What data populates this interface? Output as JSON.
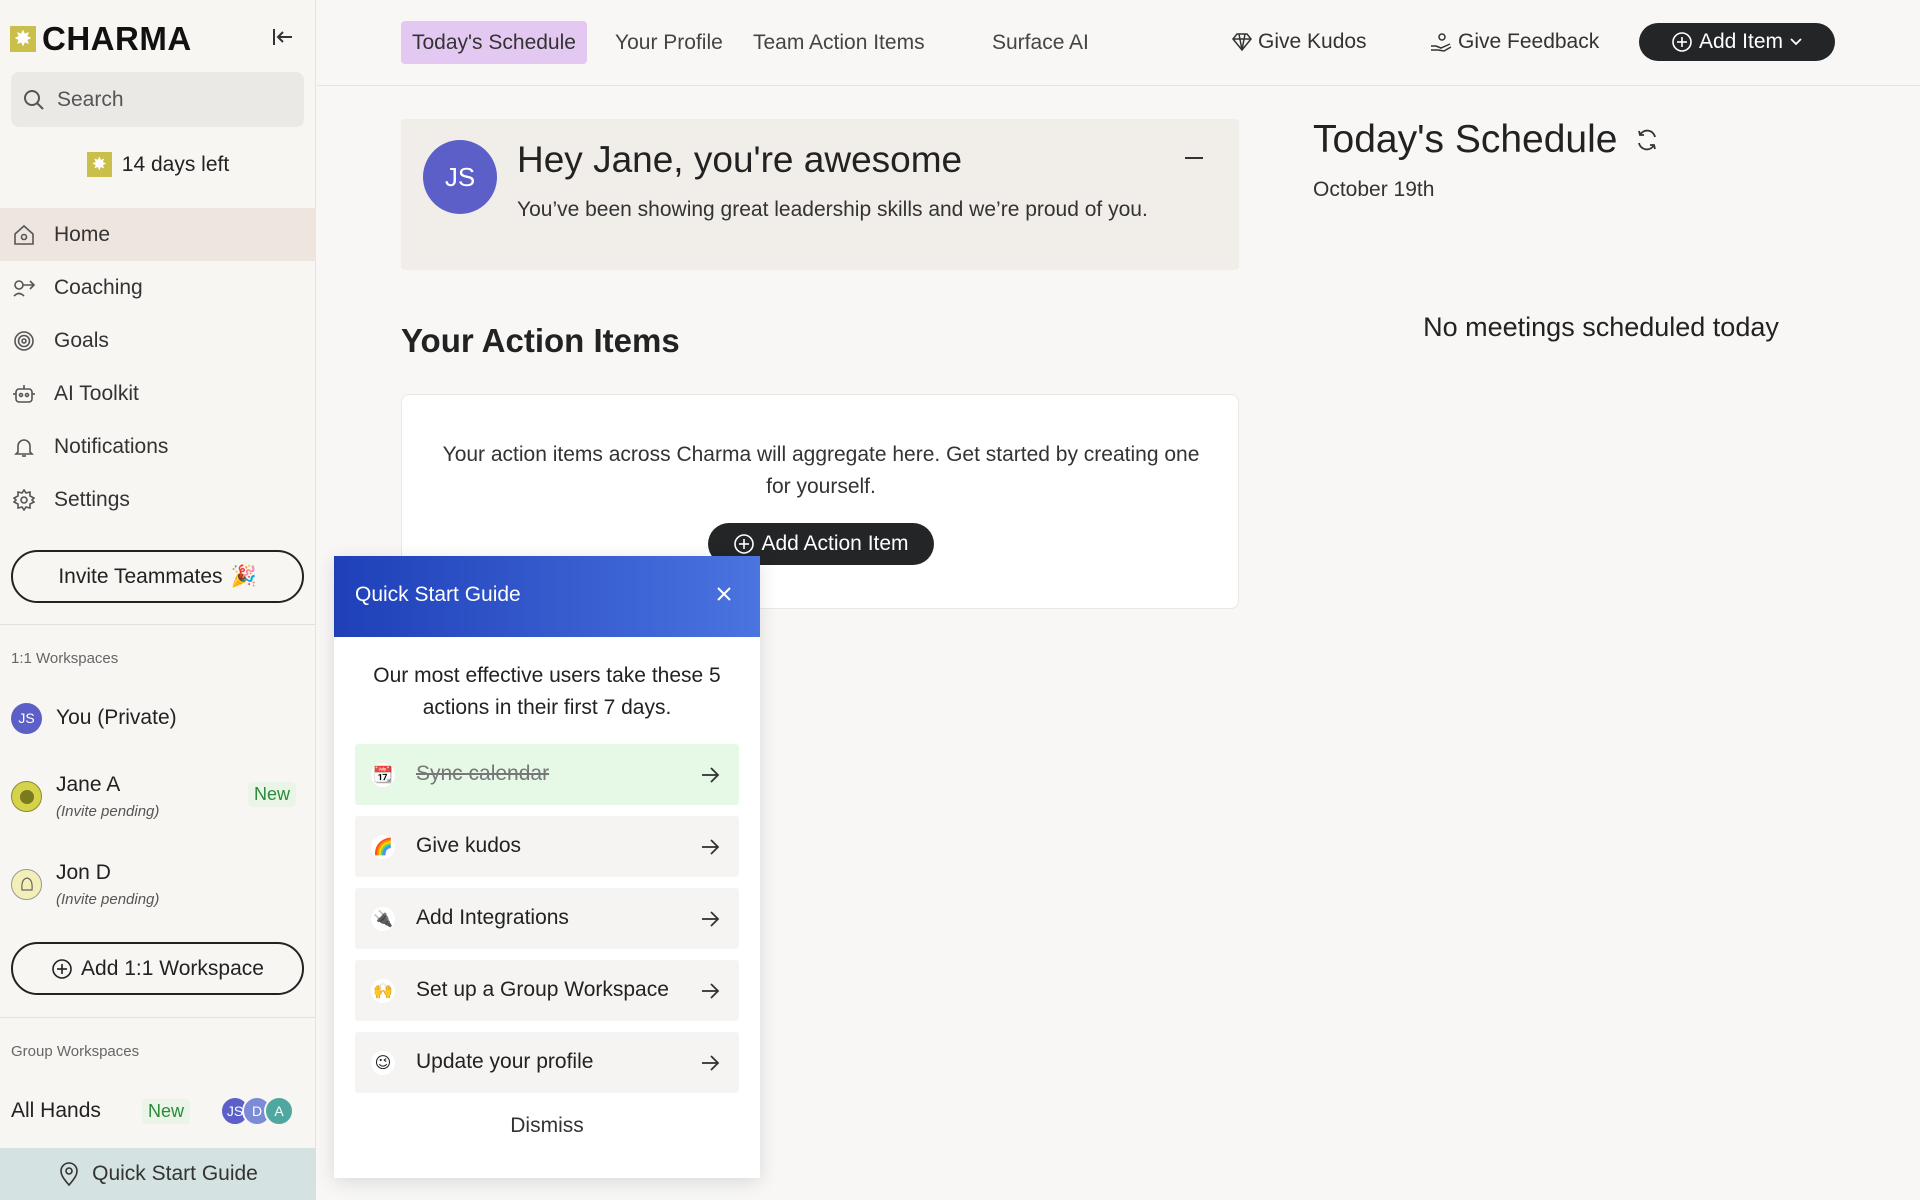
{
  "brand": {
    "name": "CHARMA"
  },
  "search": {
    "placeholder": "Search"
  },
  "trial": {
    "text": "14 days left"
  },
  "nav": [
    {
      "label": "Home",
      "icon": "home-icon"
    },
    {
      "label": "Coaching",
      "icon": "coaching-icon"
    },
    {
      "label": "Goals",
      "icon": "target-icon"
    },
    {
      "label": "AI Toolkit",
      "icon": "robot-icon"
    },
    {
      "label": "Notifications",
      "icon": "bell-icon"
    },
    {
      "label": "Settings",
      "icon": "gear-icon"
    }
  ],
  "invite": {
    "label": "Invite Teammates"
  },
  "one_on_one": {
    "label": "1:1 Workspaces",
    "items": [
      {
        "name": "You (Private)",
        "initials": "JS"
      },
      {
        "name": "Jane A",
        "sub": "(Invite pending)",
        "badge": "New"
      },
      {
        "name": "Jon D",
        "sub": "(Invite pending)"
      }
    ],
    "add_label": "Add 1:1 Workspace"
  },
  "group": {
    "label": "Group Workspaces",
    "items": [
      {
        "name": "All Hands",
        "badge": "New",
        "avatars": [
          "JS",
          "D",
          "A"
        ]
      }
    ]
  },
  "footer": {
    "label": "Quick Start Guide"
  },
  "tabs": [
    {
      "label": "Today's Schedule",
      "active": true
    },
    {
      "label": "Your Profile"
    },
    {
      "label": "Team Action Items"
    },
    {
      "label": "Surface AI"
    }
  ],
  "top_actions": {
    "kudos": "Give Kudos",
    "feedback": "Give Feedback",
    "add_item": "Add Item"
  },
  "kudos_card": {
    "initials": "JS",
    "title": "Hey Jane, you're awesome",
    "message": "You’ve been showing great leadership skills and we’re proud of you."
  },
  "action_items": {
    "title": "Your Action Items",
    "empty_text": "Your action items across Charma will aggregate here. Get started by creating one for yourself.",
    "add_label": "Add Action Item"
  },
  "schedule": {
    "title": "Today's Schedule",
    "date": "October 19th",
    "empty_text": "No meetings scheduled today"
  },
  "quick_start": {
    "title": "Quick Start Guide",
    "intro": "Our most effective users take these 5 actions in their first 7 days.",
    "steps": [
      {
        "label": "Sync calendar",
        "icon": "calendar-icon",
        "done": true
      },
      {
        "label": "Give kudos",
        "icon": "rainbow-icon"
      },
      {
        "label": "Add Integrations",
        "icon": "plug-icon"
      },
      {
        "label": "Set up a Group Workspace",
        "icon": "raised-hands-icon"
      },
      {
        "label": "Update your profile",
        "icon": "winking-face-icon"
      }
    ],
    "dismiss": "Dismiss"
  },
  "colors": {
    "accent_tab": "#e3c9f1",
    "brand_mark": "#c9bf4a",
    "avatar": "#5b5fc7",
    "dark_button": "#232526",
    "new_badge": "#2a8a3a",
    "qsg_header_start": "#1e3fb8",
    "qsg_header_end": "#4a74e0",
    "step_done": "#e6f8e6"
  }
}
